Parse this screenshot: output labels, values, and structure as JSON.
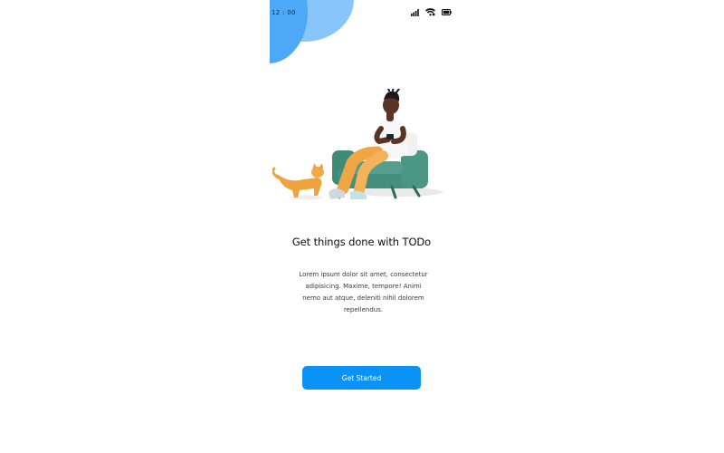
{
  "status_bar": {
    "time": "12 : 00",
    "icons": [
      "signal-icon",
      "wifi-icon",
      "battery-icon"
    ]
  },
  "illustration": {
    "name": "person-on-armchair-with-cat-illustration"
  },
  "onboarding": {
    "title": "Get things done with TODo",
    "description": "Lorem ipsum dolor sit amet, consectetur adipisicing. Maxime, tempore! Animi nemo aut atque, deleniti nihil dolorem repellendus.",
    "cta_label": "Get Started"
  },
  "colors": {
    "accent": "#0a93f5",
    "blob_light": "#88c5fb",
    "blob_dark": "#4da9f7"
  }
}
